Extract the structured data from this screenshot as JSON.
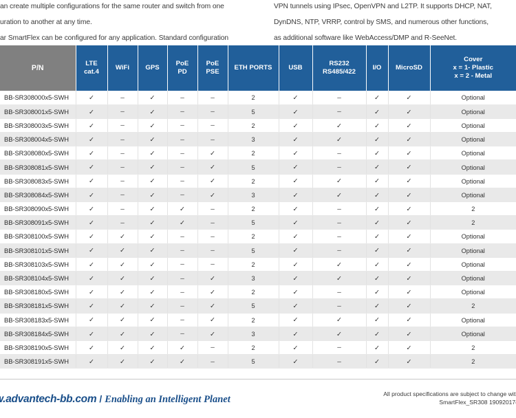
{
  "intro": {
    "left_paragraphs": [
      "an create multiple configurations for the same router and switch from one",
      "uration to another at any time.",
      "ar SmartFlex can be configured for any application. Standard configuration"
    ],
    "right_paragraphs": [
      "VPN tunnels using IPsec, OpenVPN and L2TP. It supports DHCP, NAT,",
      "DynDNS, NTP, VRRP, control by SMS, and numerous other functions,",
      "as additional software like WebAccess/DMP and R-SeeNet."
    ]
  },
  "table": {
    "headers": [
      {
        "label": "P/N",
        "lines": [
          "P/N"
        ],
        "style": "gray"
      },
      {
        "label": "LTE cat.4",
        "lines": [
          "LTE",
          "cat.4"
        ],
        "style": "blue"
      },
      {
        "label": "WiFi",
        "lines": [
          "WiFi"
        ],
        "style": "blue"
      },
      {
        "label": "GPS",
        "lines": [
          "GPS"
        ],
        "style": "blue"
      },
      {
        "label": "PoE PD",
        "lines": [
          "PoE",
          "PD"
        ],
        "style": "blue"
      },
      {
        "label": "PoE PSE",
        "lines": [
          "PoE",
          "PSE"
        ],
        "style": "blue"
      },
      {
        "label": "ETH PORTS",
        "lines": [
          "ETH PORTS"
        ],
        "style": "blue"
      },
      {
        "label": "USB",
        "lines": [
          "USB"
        ],
        "style": "blue"
      },
      {
        "label": "RS232 RS485/422",
        "lines": [
          "RS232",
          "RS485/422"
        ],
        "style": "blue"
      },
      {
        "label": "I/O",
        "lines": [
          "I/O"
        ],
        "style": "blue"
      },
      {
        "label": "MicroSD",
        "lines": [
          "MicroSD"
        ],
        "style": "blue"
      },
      {
        "label": "Cover",
        "lines": [
          "Cover",
          "x = 1- Plastic",
          "x = 2 - Metal"
        ],
        "style": "blue"
      }
    ],
    "check_glyph": "✓",
    "dash_glyph": "–",
    "rows": [
      {
        "pn": "BB-SR308000x5-SWH",
        "cells": [
          "Y",
          "N",
          "Y",
          "N",
          "N",
          "2",
          "Y",
          "N",
          "Y",
          "Y",
          "Optional"
        ]
      },
      {
        "pn": "BB-SR308001x5-SWH",
        "cells": [
          "Y",
          "N",
          "Y",
          "N",
          "N",
          "5",
          "Y",
          "N",
          "Y",
          "Y",
          "Optional"
        ]
      },
      {
        "pn": "BB-SR308003x5-SWH",
        "cells": [
          "Y",
          "N",
          "Y",
          "N",
          "N",
          "2",
          "Y",
          "Y",
          "Y",
          "Y",
          "Optional"
        ]
      },
      {
        "pn": "BB-SR308004x5-SWH",
        "cells": [
          "Y",
          "N",
          "Y",
          "N",
          "N",
          "3",
          "Y",
          "Y",
          "Y",
          "Y",
          "Optional"
        ]
      },
      {
        "pn": "BB-SR308080x5-SWH",
        "cells": [
          "Y",
          "N",
          "Y",
          "N",
          "Y",
          "2",
          "Y",
          "N",
          "Y",
          "Y",
          "Optional"
        ]
      },
      {
        "pn": "BB-SR308081x5-SWH",
        "cells": [
          "Y",
          "N",
          "Y",
          "N",
          "Y",
          "5",
          "Y",
          "N",
          "Y",
          "Y",
          "Optional"
        ]
      },
      {
        "pn": "BB-SR308083x5-SWH",
        "cells": [
          "Y",
          "N",
          "Y",
          "N",
          "Y",
          "2",
          "Y",
          "Y",
          "Y",
          "Y",
          "Optional"
        ]
      },
      {
        "pn": "BB-SR308084x5-SWH",
        "cells": [
          "Y",
          "N",
          "Y",
          "N",
          "Y",
          "3",
          "Y",
          "Y",
          "Y",
          "Y",
          "Optional"
        ]
      },
      {
        "pn": "BB-SR308090x5-SWH",
        "cells": [
          "Y",
          "N",
          "Y",
          "Y",
          "N",
          "2",
          "Y",
          "N",
          "Y",
          "Y",
          "2"
        ]
      },
      {
        "pn": "BB-SR308091x5-SWH",
        "cells": [
          "Y",
          "N",
          "Y",
          "Y",
          "N",
          "5",
          "Y",
          "N",
          "Y",
          "Y",
          "2"
        ]
      },
      {
        "pn": "BB-SR308100x5-SWH",
        "cells": [
          "Y",
          "Y",
          "Y",
          "N",
          "N",
          "2",
          "Y",
          "N",
          "Y",
          "Y",
          "Optional"
        ]
      },
      {
        "pn": "BB-SR308101x5-SWH",
        "cells": [
          "Y",
          "Y",
          "Y",
          "N",
          "N",
          "5",
          "Y",
          "N",
          "Y",
          "Y",
          "Optional"
        ]
      },
      {
        "pn": "BB-SR308103x5-SWH",
        "cells": [
          "Y",
          "Y",
          "Y",
          "N",
          "N",
          "2",
          "Y",
          "Y",
          "Y",
          "Y",
          "Optional"
        ]
      },
      {
        "pn": "BB-SR308104x5-SWH",
        "cells": [
          "Y",
          "Y",
          "Y",
          "N",
          "Y",
          "3",
          "Y",
          "Y",
          "Y",
          "Y",
          "Optional"
        ]
      },
      {
        "pn": "BB-SR308180x5-SWH",
        "cells": [
          "Y",
          "Y",
          "Y",
          "N",
          "Y",
          "2",
          "Y",
          "N",
          "Y",
          "Y",
          "Optional"
        ]
      },
      {
        "pn": "BB-SR308181x5-SWH",
        "cells": [
          "Y",
          "Y",
          "Y",
          "N",
          "Y",
          "5",
          "Y",
          "N",
          "Y",
          "Y",
          "2"
        ]
      },
      {
        "pn": "BB-SR308183x5-SWH",
        "cells": [
          "Y",
          "Y",
          "Y",
          "N",
          "Y",
          "2",
          "Y",
          "Y",
          "Y",
          "Y",
          "Optional"
        ]
      },
      {
        "pn": "BB-SR308184x5-SWH",
        "cells": [
          "Y",
          "Y",
          "Y",
          "N",
          "Y",
          "3",
          "Y",
          "Y",
          "Y",
          "Y",
          "Optional"
        ]
      },
      {
        "pn": "BB-SR308190x5-SWH",
        "cells": [
          "Y",
          "Y",
          "Y",
          "Y",
          "N",
          "2",
          "Y",
          "N",
          "Y",
          "Y",
          "2"
        ]
      },
      {
        "pn": "BB-SR308191x5-SWH",
        "cells": [
          "Y",
          "Y",
          "Y",
          "Y",
          "N",
          "5",
          "Y",
          "N",
          "Y",
          "Y",
          "2"
        ]
      }
    ]
  },
  "footer": {
    "url": "w.advantech-bb.com",
    "separator": "/",
    "tagline": "Enabling an Intelligent Planet",
    "disclaimer_line1": "All product specifications are subject to change with",
    "disclaimer_line2": "SmartFlex_SR308 19092017d"
  },
  "colors": {
    "header_blue": "#215f9a",
    "header_gray": "#808080",
    "brand_blue": "#1a4f8a",
    "row_alt": "#e9e9e9"
  }
}
